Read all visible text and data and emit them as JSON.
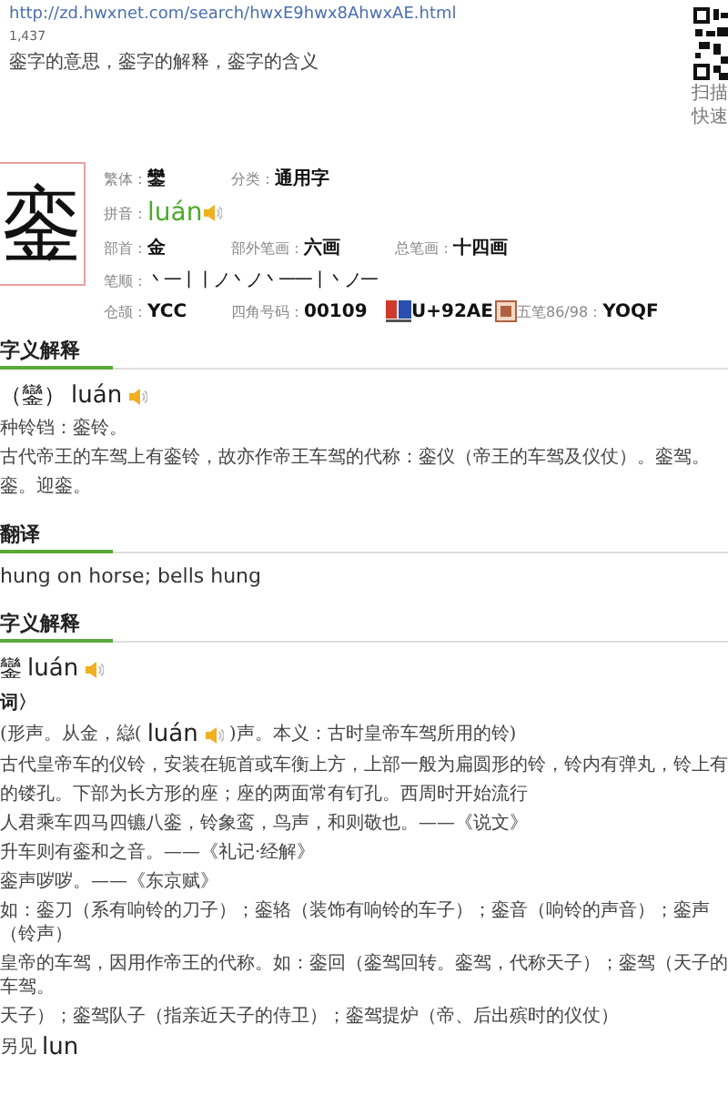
{
  "url": "http://zd.hwxnet.com/search/hwxE9hwx8AhwxAE.html",
  "count": "1,437",
  "page_title": "銮字的意思，銮字的解释，銮字的含义",
  "qr_caption": [
    "扫描",
    "快速"
  ],
  "character": "銮",
  "info": [
    [
      {
        "label": "繁体：",
        "value": "鑾",
        "kind": "text"
      },
      {
        "label": "分类：",
        "value": "通用字",
        "kind": "text"
      }
    ],
    [
      {
        "label": "拼音：",
        "value": "luán",
        "kind": "pinyin"
      }
    ],
    [
      {
        "label": "部首：",
        "value": "金",
        "kind": "text"
      },
      {
        "label": "部外笔画：",
        "value": "六画",
        "kind": "text"
      },
      {
        "label": "总笔画：",
        "value": "十四画",
        "kind": "text"
      }
    ],
    [
      {
        "label": "笔顺：",
        "value": "丶一丨丨ノ丶ノ丶一一丨丶ノ一",
        "kind": "stroke"
      }
    ],
    [
      {
        "label": "仓颉：",
        "value": "YCC",
        "kind": "text"
      },
      {
        "label": "四角号码：",
        "value": "00109",
        "kind": "text"
      },
      {
        "value": "U+92AE",
        "kind": "unicode"
      },
      {
        "label": "五笔86/98：",
        "value": "YOQF",
        "kind": "wubi"
      }
    ]
  ],
  "sections": [
    {
      "title": "字义解释",
      "lines": [
        {
          "kind": "heading",
          "text": "（鑾）",
          "pinyin": "luán"
        },
        {
          "kind": "text",
          "text": "种铃铛：銮铃。"
        },
        {
          "kind": "text",
          "text": "古代帝王的车驾上有銮铃，故亦作帝王车驾的代称：銮仪（帝王的车驾及仪仗）。銮驾。"
        },
        {
          "kind": "text",
          "text": "銮。迎銮。"
        }
      ]
    },
    {
      "title": "翻译",
      "lines": [
        {
          "kind": "english",
          "text": "hung on horse; bells hung"
        }
      ]
    },
    {
      "title": "字义解释",
      "lines": [
        {
          "kind": "heading",
          "text": "鑾",
          "pinyin": "luán"
        },
        {
          "kind": "bold",
          "text": "词〉"
        },
        {
          "kind": "inline_audio",
          "text": "(形声。从金，䜌(",
          "pinyin": "luán",
          "after": ")声。本义：古时皇帝车驾所用的铃)"
        },
        {
          "kind": "text",
          "text": "古代皇帝车的仪铃，安装在轭首或车衡上方，上部一般为扁圆形的铃，铃内有弹丸，铃上有"
        },
        {
          "kind": "text",
          "text": "的镂孔。下部为长方形的座；座的两面常有钉孔。西周时开始流行"
        },
        {
          "kind": "text",
          "text": "人君乘车四马四镳八銮，铃象鸾，鸟声，和则敬也。——《说文》"
        },
        {
          "kind": "text",
          "text": "升车则有銮和之音。——《礼记·经解》"
        },
        {
          "kind": "text",
          "text": "銮声哕哕。——《东京赋》"
        },
        {
          "kind": "text",
          "text": "如：銮刀（系有响铃的刀子）；銮辂（装饰有响铃的车子）；銮音（响铃的声音）；銮声（铃声）"
        },
        {
          "kind": "text",
          "text": "皇帝的车驾，因用作帝王的代称。如：銮回（銮驾回转。銮驾，代称天子）；銮驾（天子的车驾。"
        },
        {
          "kind": "text",
          "text": "天子）；銮驾队子（指亲近天子的侍卫）；銮驾提炉（帝、后出殡时的仪仗）"
        },
        {
          "kind": "seealso",
          "text": "另见",
          "pinyin": "lun"
        }
      ]
    }
  ]
}
